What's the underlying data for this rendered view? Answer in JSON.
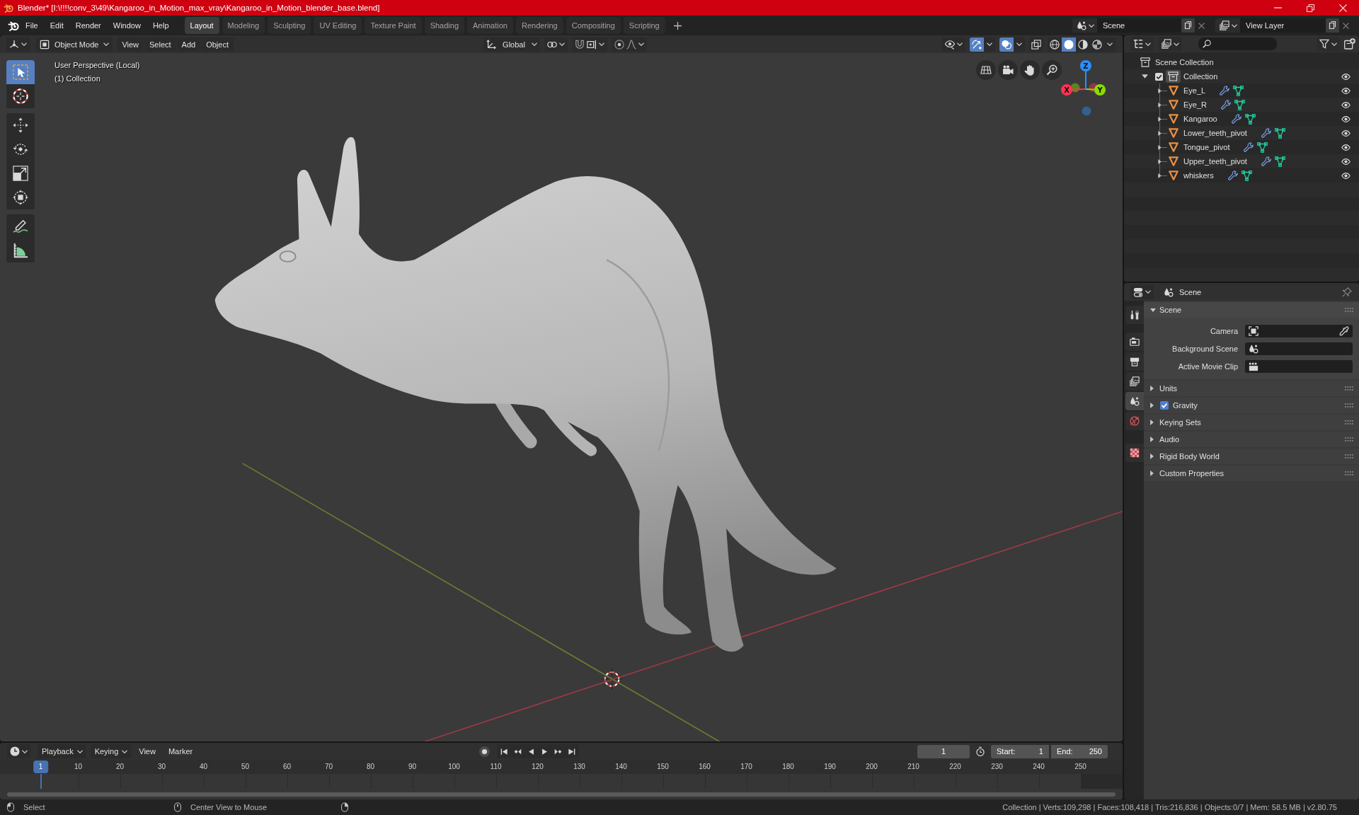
{
  "window": {
    "title": "Blender* [I:\\!!!!conv_3\\49\\Kangaroo_in_Motion_max_vray\\Kangaroo_in_Motion_blender_base.blend]"
  },
  "menu": [
    "File",
    "Edit",
    "Render",
    "Window",
    "Help"
  ],
  "workspace_tabs": [
    {
      "label": "Layout",
      "selected": true
    },
    {
      "label": "Modeling",
      "selected": false
    },
    {
      "label": "Sculpting",
      "selected": false
    },
    {
      "label": "UV Editing",
      "selected": false
    },
    {
      "label": "Texture Paint",
      "selected": false
    },
    {
      "label": "Shading",
      "selected": false
    },
    {
      "label": "Animation",
      "selected": false
    },
    {
      "label": "Rendering",
      "selected": false
    },
    {
      "label": "Compositing",
      "selected": false
    },
    {
      "label": "Scripting",
      "selected": false
    }
  ],
  "scene_selector": {
    "value": "Scene"
  },
  "view_layer_selector": {
    "value": "View Layer"
  },
  "viewport": {
    "mode": "Object Mode",
    "menus": [
      "View",
      "Select",
      "Add",
      "Object"
    ],
    "orientation": "Global",
    "toggles": [
      {
        "kind": "gizmo",
        "on": true
      },
      {
        "kind": "overlay",
        "on": true
      },
      {
        "kind": "xray",
        "on": false
      }
    ],
    "shading": [
      {
        "kind": "wireframe",
        "selected": false
      },
      {
        "kind": "solid",
        "selected": true
      },
      {
        "kind": "material",
        "selected": false
      },
      {
        "kind": "rendered",
        "selected": false
      }
    ],
    "tool_groups": [
      {
        "tools": [
          {
            "kind": "select_box",
            "selected": true
          },
          {
            "kind": "cursor",
            "selected": false
          }
        ]
      },
      {
        "tools": [
          {
            "kind": "move",
            "selected": false
          },
          {
            "kind": "rotate",
            "selected": false
          },
          {
            "kind": "scale",
            "selected": false
          },
          {
            "kind": "transform",
            "selected": false
          }
        ]
      },
      {
        "tools": [
          {
            "kind": "annotate",
            "selected": false
          },
          {
            "kind": "measure",
            "selected": false
          }
        ]
      }
    ],
    "info": [
      "User Perspective (Local)",
      "(1) Collection"
    ],
    "axes": [
      {
        "label": "X",
        "color": "#ff3352"
      },
      {
        "label": "Y",
        "color": "#8bdc00"
      },
      {
        "label": "Z",
        "color": "#2890ff"
      }
    ]
  },
  "outliner": {
    "root": "Scene Collection",
    "collections": [
      {
        "label": "Collection",
        "checked": true,
        "expanded": true,
        "visible": true,
        "children": [
          {
            "label": "Eye_L",
            "expanded": false,
            "visible": true
          },
          {
            "label": "Eye_R",
            "expanded": false,
            "visible": true
          },
          {
            "label": "Kangaroo",
            "expanded": false,
            "visible": true
          },
          {
            "label": "Lower_teeth_pivot",
            "expanded": false,
            "visible": true
          },
          {
            "label": "Tongue_pivot",
            "expanded": false,
            "visible": true
          },
          {
            "label": "Upper_teeth_pivot",
            "expanded": false,
            "visible": true
          },
          {
            "label": "whiskers",
            "expanded": false,
            "visible": true
          }
        ]
      }
    ]
  },
  "properties": {
    "context": "Scene",
    "tabs": [
      {
        "kind": "tool",
        "selected": false
      },
      {
        "kind": "render",
        "selected": false
      },
      {
        "kind": "output",
        "selected": false
      },
      {
        "kind": "view_layer",
        "selected": false
      },
      {
        "kind": "scene",
        "selected": true
      },
      {
        "kind": "world",
        "selected": false
      },
      {
        "kind": "texture",
        "selected": false
      }
    ],
    "panels": [
      {
        "title": "Scene",
        "kind": "plain",
        "expanded": true,
        "fields": [
          {
            "label": "Camera",
            "kind": "camera"
          },
          {
            "label": "Background Scene",
            "kind": "scene"
          },
          {
            "label": "Active Movie Clip",
            "kind": "clip"
          }
        ]
      },
      {
        "title": "Units",
        "kind": "plain",
        "expanded": false
      },
      {
        "title": "Gravity",
        "kind": "toggle",
        "expanded": false,
        "checked": true
      },
      {
        "title": "Keying Sets",
        "kind": "plain",
        "expanded": false
      },
      {
        "title": "Audio",
        "kind": "plain",
        "expanded": false
      },
      {
        "title": "Rigid Body World",
        "kind": "plain",
        "expanded": false
      },
      {
        "title": "Custom Properties",
        "kind": "plain",
        "expanded": false
      }
    ]
  },
  "timeline": {
    "menus": [
      {
        "label": "Playback",
        "kind": "dropdown"
      },
      {
        "label": "Keying",
        "kind": "dropdown"
      },
      {
        "label": "View",
        "kind": "menu"
      },
      {
        "label": "Marker",
        "kind": "menu"
      }
    ],
    "current_frame": "1",
    "start": {
      "label": "Start:",
      "value": "1"
    },
    "end": {
      "label": "End:",
      "value": "250"
    },
    "ruler": [
      {
        "label": "1",
        "selected": true
      },
      {
        "label": "10",
        "selected": false
      },
      {
        "label": "20",
        "selected": false
      },
      {
        "label": "30",
        "selected": false
      },
      {
        "label": "40",
        "selected": false
      },
      {
        "label": "50",
        "selected": false
      },
      {
        "label": "60",
        "selected": false
      },
      {
        "label": "70",
        "selected": false
      },
      {
        "label": "80",
        "selected": false
      },
      {
        "label": "90",
        "selected": false
      },
      {
        "label": "100",
        "selected": false
      },
      {
        "label": "110",
        "selected": false
      },
      {
        "label": "120",
        "selected": false
      },
      {
        "label": "130",
        "selected": false
      },
      {
        "label": "140",
        "selected": false
      },
      {
        "label": "150",
        "selected": false
      },
      {
        "label": "160",
        "selected": false
      },
      {
        "label": "170",
        "selected": false
      },
      {
        "label": "180",
        "selected": false
      },
      {
        "label": "190",
        "selected": false
      },
      {
        "label": "200",
        "selected": false
      },
      {
        "label": "210",
        "selected": false
      },
      {
        "label": "220",
        "selected": false
      },
      {
        "label": "230",
        "selected": false
      },
      {
        "label": "240",
        "selected": false
      },
      {
        "label": "250",
        "selected": false
      }
    ]
  },
  "status_bar": {
    "hints": [
      {
        "kind": "mouse_left",
        "label": "Select"
      },
      {
        "kind": "mouse_middle",
        "label": "Center View to Mouse"
      },
      {
        "kind": "mouse_right"
      }
    ],
    "stats": "Collection | Verts:109,298 | Faces:108,418 | Tris:216,836 | Objects:0/7 | Mem: 58.5 MB | v2.80.75"
  }
}
